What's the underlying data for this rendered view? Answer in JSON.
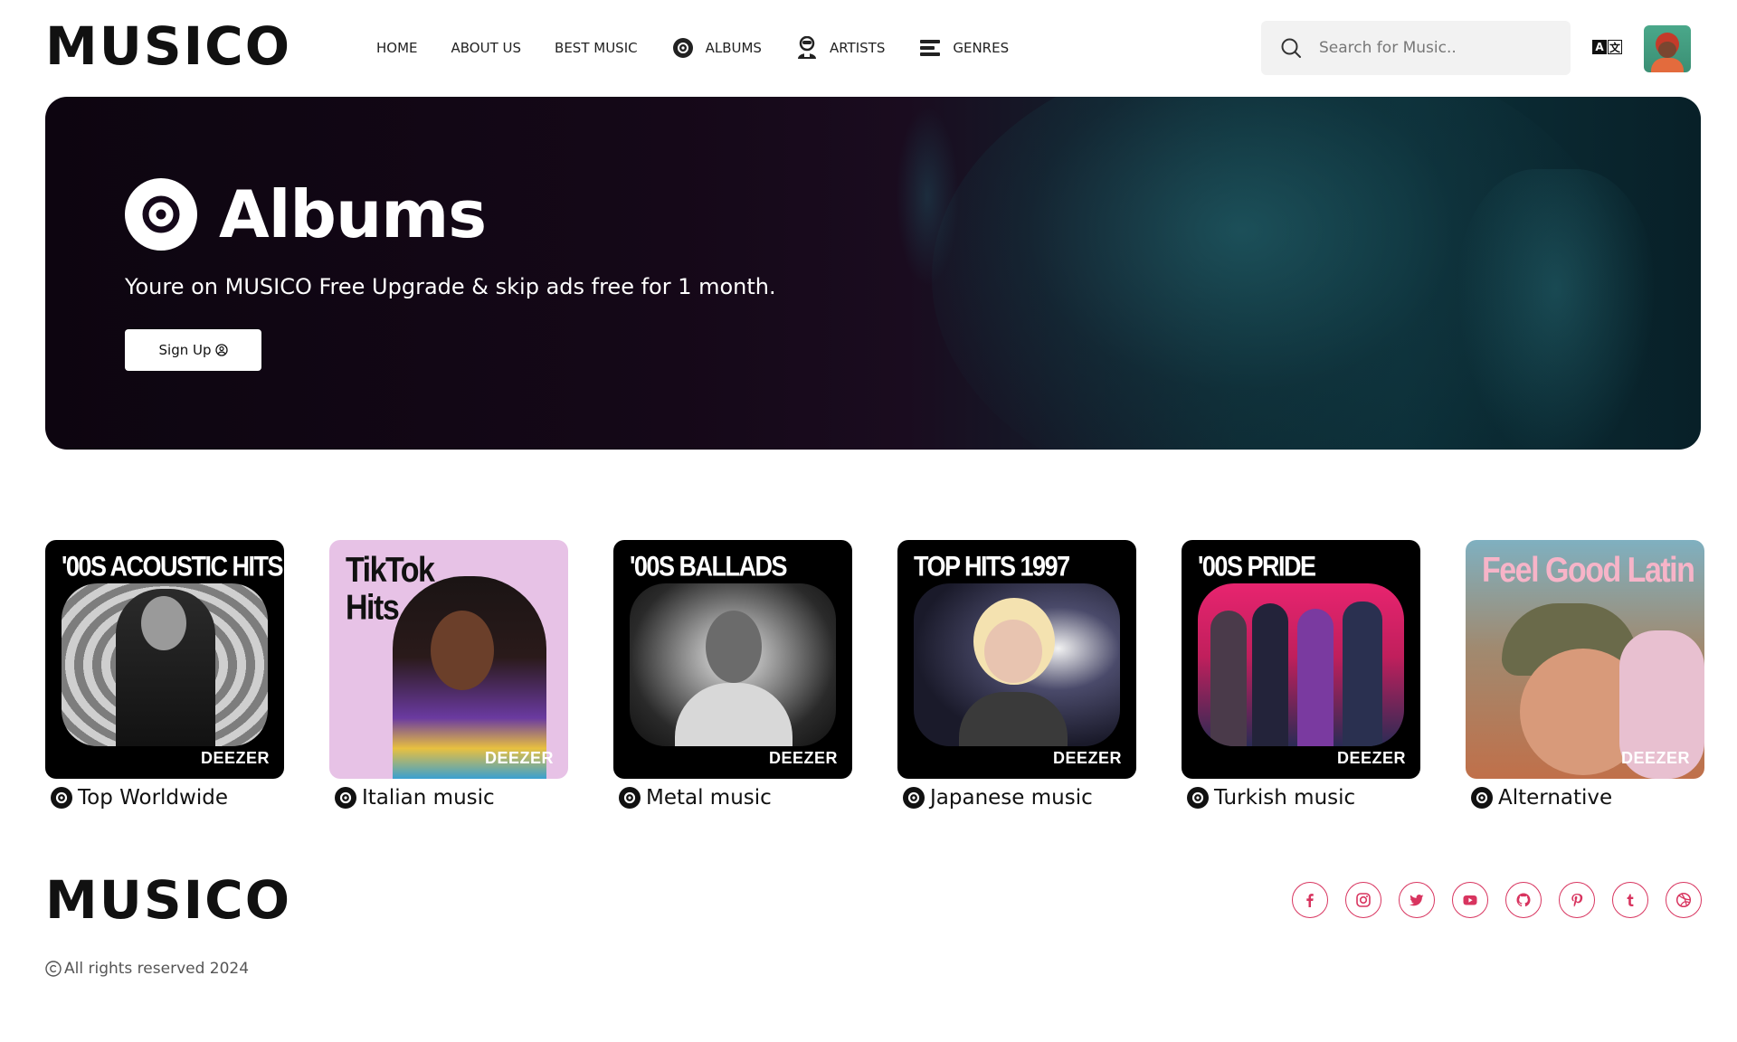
{
  "brand": {
    "logo_text": "MUSICO"
  },
  "nav": {
    "items": [
      {
        "label": "HOME",
        "icon": ""
      },
      {
        "label": "ABOUT US",
        "icon": ""
      },
      {
        "label": "BEST MUSIC",
        "icon": ""
      },
      {
        "label": "ALBUMS",
        "icon": "disc-icon"
      },
      {
        "label": "ARTISTS",
        "icon": "artist-icon"
      },
      {
        "label": "GENRES",
        "icon": "genres-icon"
      }
    ]
  },
  "search": {
    "placeholder": "Search for Music.."
  },
  "header_icons": {
    "translate": "translate-icon",
    "avatar": "user-avatar"
  },
  "hero": {
    "title": "Albums",
    "subtitle": "Youre on MUSICO Free Upgrade & skip ads free for 1 month.",
    "button_label": "Sign Up"
  },
  "albums": [
    {
      "cover_title": "'00S ACOUSTIC HITS",
      "label": "Top Worldwide",
      "badge": "DEEZER",
      "bg": "#000000"
    },
    {
      "cover_title": "TikTok Hits",
      "label": "Italian music",
      "badge": "DEEZER",
      "bg": "#e7c2e6"
    },
    {
      "cover_title": "'00S BALLADS",
      "label": "Metal music",
      "badge": "DEEZER",
      "bg": "#000000"
    },
    {
      "cover_title": "TOP HITS 1997",
      "label": "Japanese music",
      "badge": "DEEZER",
      "bg": "#000000"
    },
    {
      "cover_title": "'00S PRIDE",
      "label": "Turkish music",
      "badge": "DEEZER",
      "bg": "#000000"
    },
    {
      "cover_title": "Feel Good Latin",
      "label": "Alternative",
      "badge": "DEEZER",
      "bg": "#7a9aa0"
    }
  ],
  "footer": {
    "logo_text": "MUSICO",
    "copyright": "All rights reserved 2024",
    "social_icons": [
      "facebook-icon",
      "instagram-icon",
      "twitter-icon",
      "youtube-icon",
      "github-icon",
      "pinterest-icon",
      "tumblr-icon",
      "dribbble-icon"
    ],
    "accent_color": "#d8345f"
  }
}
